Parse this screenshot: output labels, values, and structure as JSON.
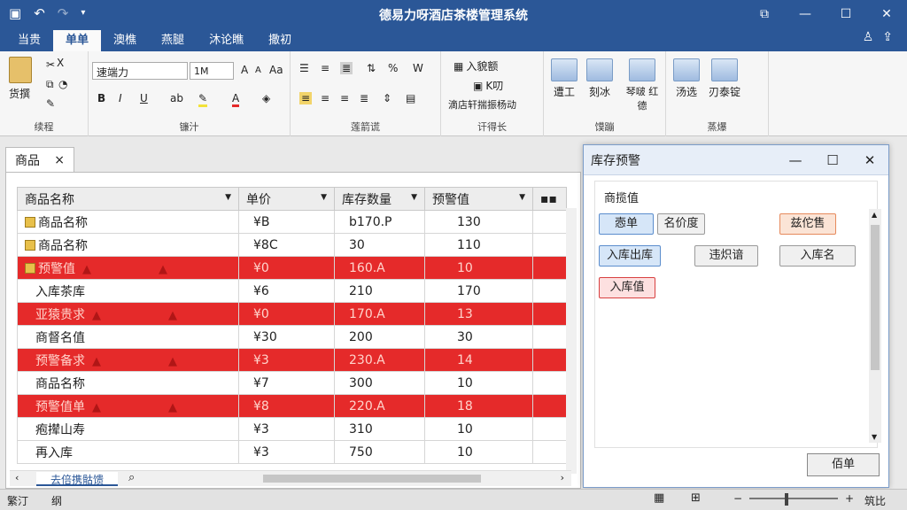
{
  "window": {
    "title": "德易力呀酒店茶楼管理系统",
    "controls": [
      "⧉",
      "—",
      "☐",
      "✕"
    ]
  },
  "ribbon_tabs": [
    "当贵",
    "单单",
    "澳樵",
    "燕腿",
    "沐论瞧",
    "撒初"
  ],
  "ribbon_active": 1,
  "ribbon": {
    "paste_label": "货撰",
    "group_clipboard": "续程",
    "font_name": "速端力",
    "font_size": "1M",
    "group_font": "镰汁",
    "group_para": "莲箭谎",
    "group_insert": "讦得长",
    "insert_items": [
      "入貌额",
      "K叨",
      "滴店轩揣振杨动"
    ],
    "group_edit": "馍蹦",
    "edit_buttons": [
      "遭工",
      "刻冰",
      "琴啵 红德"
    ],
    "group_view": "蒸爆",
    "view_buttons": [
      "汤选",
      "刃泰锭"
    ]
  },
  "doc_tab": {
    "label": "商品",
    "close": "×"
  },
  "table": {
    "headers": [
      "商品名称",
      "单价",
      "库存数量",
      "预警值"
    ],
    "rows": [
      {
        "name": "商品名称",
        "price": "¥B",
        "stock": "b170.P",
        "warn": "130",
        "alert": false,
        "folder": true,
        "tri": 0
      },
      {
        "name": "商品名称",
        "price": "¥8C",
        "stock": "30",
        "warn": "110",
        "alert": false,
        "folder": true,
        "tri": 0
      },
      {
        "name": "预警值",
        "price": "¥0",
        "stock": "160.A",
        "warn": "10",
        "alert": true,
        "folder": true,
        "tri": 2
      },
      {
        "name": "入库茶库",
        "price": "¥6",
        "stock": "210",
        "warn": "170",
        "alert": false,
        "folder": false,
        "tri": 0
      },
      {
        "name": "亚猿贵求",
        "price": "¥0",
        "stock": "170.A",
        "warn": "13",
        "alert": true,
        "folder": false,
        "tri": 2
      },
      {
        "name": "商督名值",
        "price": "¥30",
        "stock": "200",
        "warn": "30",
        "alert": false,
        "folder": false,
        "tri": 0
      },
      {
        "name": "预警备求",
        "price": "¥3",
        "stock": "230.A",
        "warn": "14",
        "alert": true,
        "folder": false,
        "tri": 2
      },
      {
        "name": "商品名称",
        "price": "¥7",
        "stock": "300",
        "warn": "10",
        "alert": false,
        "folder": false,
        "tri": 0
      },
      {
        "name": "预警值单",
        "price": "¥8",
        "stock": "220.A",
        "warn": "18",
        "alert": true,
        "folder": false,
        "tri": 2
      },
      {
        "name": "疱撵山寿",
        "price": "¥3",
        "stock": "310",
        "warn": "10",
        "alert": false,
        "folder": false,
        "tri": 0
      },
      {
        "name": "再入库",
        "price": "¥3",
        "stock": "750",
        "warn": "10",
        "alert": false,
        "folder": false,
        "tri": 0
      }
    ]
  },
  "sheet_tab": "去倍携骷馈",
  "panel": {
    "title": "库存预警",
    "legend": "商揽值",
    "buttons": [
      "悫单",
      "名价度",
      "兹佗售",
      "入库出库",
      "违炽谙",
      "入库名",
      "入库值"
    ],
    "ok": "佰单"
  },
  "status": {
    "left": "繁汀",
    "middle": "纲",
    "right": "筑比"
  },
  "colors": {
    "titlebar": "#2b5797",
    "alert_row": "#e52a2a"
  }
}
